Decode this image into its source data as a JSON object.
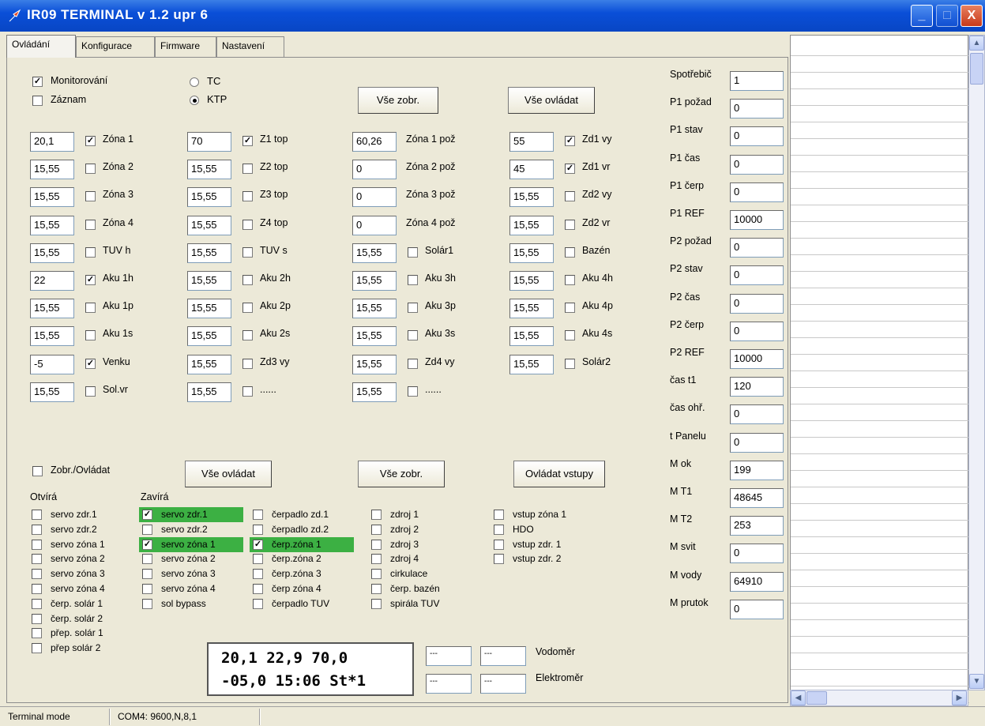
{
  "window": {
    "title": "IR09 TERMINAL v 1.2 upr 6",
    "min": "_",
    "max": "□",
    "close": "X"
  },
  "tabs": [
    "Ovládání",
    "Konfigurace",
    "Firmware",
    "Nastavení"
  ],
  "top": {
    "monitorovani": {
      "label": "Monitorování",
      "checked": true
    },
    "zaznam": {
      "label": "Záznam",
      "checked": false
    },
    "tc": {
      "label": "TC",
      "selected": false
    },
    "ktp": {
      "label": "KTP",
      "selected": true
    },
    "btn_vse_zobr": "Vše zobr.",
    "btn_vse_ovladat": "Vše ovládat"
  },
  "sensors": [
    [
      {
        "v": "20,1",
        "l": "Zóna 1",
        "c": true
      },
      {
        "v": "70",
        "l": "Z1 top",
        "c": true
      },
      {
        "v": "60,26",
        "l": "Zóna 1 pož",
        "c": null
      },
      {
        "v": "55",
        "l": "Zd1 vy",
        "c": true
      }
    ],
    [
      {
        "v": "15,55",
        "l": "Zóna 2",
        "c": false
      },
      {
        "v": "15,55",
        "l": "Z2 top",
        "c": false
      },
      {
        "v": "0",
        "l": "Zóna 2 pož",
        "c": null
      },
      {
        "v": "45",
        "l": "Zd1 vr",
        "c": true
      }
    ],
    [
      {
        "v": "15,55",
        "l": "Zóna 3",
        "c": false
      },
      {
        "v": "15,55",
        "l": "Z3 top",
        "c": false
      },
      {
        "v": "0",
        "l": "Zóna 3 pož",
        "c": null
      },
      {
        "v": "15,55",
        "l": "Zd2 vy",
        "c": false
      }
    ],
    [
      {
        "v": "15,55",
        "l": "Zóna 4",
        "c": false
      },
      {
        "v": "15,55",
        "l": "Z4 top",
        "c": false
      },
      {
        "v": "0",
        "l": "Zóna 4 pož",
        "c": null
      },
      {
        "v": "15,55",
        "l": "Zd2 vr",
        "c": false
      }
    ],
    [
      {
        "v": "15,55",
        "l": "TUV h",
        "c": false
      },
      {
        "v": "15,55",
        "l": "TUV s",
        "c": false
      },
      {
        "v": "15,55",
        "l": "Solár1",
        "c": false
      },
      {
        "v": "15,55",
        "l": "Bazén",
        "c": false
      }
    ],
    [
      {
        "v": "22",
        "l": "Aku 1h",
        "c": true
      },
      {
        "v": "15,55",
        "l": "Aku 2h",
        "c": false
      },
      {
        "v": "15,55",
        "l": "Aku 3h",
        "c": false
      },
      {
        "v": "15,55",
        "l": "Aku 4h",
        "c": false
      }
    ],
    [
      {
        "v": "15,55",
        "l": "Aku 1p",
        "c": false
      },
      {
        "v": "15,55",
        "l": "Aku 2p",
        "c": false
      },
      {
        "v": "15,55",
        "l": "Aku 3p",
        "c": false
      },
      {
        "v": "15,55",
        "l": "Aku 4p",
        "c": false
      }
    ],
    [
      {
        "v": "15,55",
        "l": "Aku 1s",
        "c": false
      },
      {
        "v": "15,55",
        "l": "Aku 2s",
        "c": false
      },
      {
        "v": "15,55",
        "l": "Aku 3s",
        "c": false
      },
      {
        "v": "15,55",
        "l": "Aku 4s",
        "c": false
      }
    ],
    [
      {
        "v": "-5",
        "l": "Venku",
        "c": true
      },
      {
        "v": "15,55",
        "l": "Zd3 vy",
        "c": false
      },
      {
        "v": "15,55",
        "l": "Zd4 vy",
        "c": false
      },
      {
        "v": "15,55",
        "l": "Solár2",
        "c": false
      }
    ],
    [
      {
        "v": "15,55",
        "l": "Sol.vr",
        "c": false
      },
      {
        "v": "15,55",
        "l": "......",
        "c": false
      },
      {
        "v": "15,55",
        "l": "......",
        "c": false
      },
      null
    ]
  ],
  "bottom": {
    "zobr_ovladat": {
      "label": "Zobr./Ovládat",
      "checked": false
    },
    "btn_vse_ovladat": "Vše ovládat",
    "btn_vse_zobr": "Vše zobr.",
    "btn_ovladat_vstupy": "Ovládat vstupy",
    "otvira_title": "Otvírá",
    "zavira_title": "Zavírá",
    "col1": [
      {
        "l": "servo zdr.1",
        "c": false
      },
      {
        "l": "servo zdr.2",
        "c": false
      },
      {
        "l": "servo zóna 1",
        "c": false
      },
      {
        "l": "servo zóna 2",
        "c": false
      },
      {
        "l": "servo zóna 3",
        "c": false
      },
      {
        "l": "servo zóna 4",
        "c": false
      },
      {
        "l": "čerp. solár 1",
        "c": false
      },
      {
        "l": "čerp. solár 2",
        "c": false
      },
      {
        "l": "přep. solár 1",
        "c": false
      },
      {
        "l": "přep solár 2",
        "c": false
      }
    ],
    "col2": [
      {
        "l": "servo zdr.1",
        "c": true,
        "hl": true
      },
      {
        "l": "servo zdr.2",
        "c": false
      },
      {
        "l": "servo zóna 1",
        "c": true,
        "hl": true
      },
      {
        "l": "servo zóna 2",
        "c": false
      },
      {
        "l": "servo zóna 3",
        "c": false
      },
      {
        "l": "servo zóna 4",
        "c": false
      },
      {
        "l": "sol bypass",
        "c": false
      }
    ],
    "col3": [
      {
        "l": "čerpadlo zd.1",
        "c": false
      },
      {
        "l": "čerpadlo zd.2",
        "c": false
      },
      {
        "l": "čerp.zóna 1",
        "c": true,
        "hl": true
      },
      {
        "l": "čerp.zóna 2",
        "c": false
      },
      {
        "l": "čerp.zóna 3",
        "c": false
      },
      {
        "l": "čerp zóna 4",
        "c": false
      },
      {
        "l": "čerpadlo TUV",
        "c": false
      }
    ],
    "col4": [
      {
        "l": "zdroj 1",
        "c": false
      },
      {
        "l": "zdroj 2",
        "c": false
      },
      {
        "l": "zdroj 3",
        "c": false
      },
      {
        "l": "zdroj 4",
        "c": false
      },
      {
        "l": "cirkulace",
        "c": false
      },
      {
        "l": "čerp. bazén",
        "c": false
      },
      {
        "l": "spirála TUV",
        "c": false
      }
    ],
    "col5": [
      {
        "l": "vstup zóna 1",
        "c": false
      },
      {
        "l": "HDO",
        "c": false
      },
      {
        "l": "vstup zdr. 1",
        "c": false
      },
      {
        "l": "vstup zdr. 2",
        "c": false
      }
    ],
    "lcd": {
      "line1": "20,1 22,9 70,0",
      "line2": "-05,0 15:06 St*1"
    },
    "vodomer": {
      "label": "Vodoměr",
      "a": "---",
      "b": "---"
    },
    "elektromer": {
      "label": "Elektroměr",
      "a": "---",
      "b": "---"
    }
  },
  "params": [
    {
      "l": "Spotřebič",
      "v": "1"
    },
    {
      "l": "P1 požad",
      "v": "0"
    },
    {
      "l": "P1 stav",
      "v": "0"
    },
    {
      "l": "P1 čas",
      "v": "0"
    },
    {
      "l": "P1 čerp",
      "v": "0"
    },
    {
      "l": "P1 REF",
      "v": "10000"
    },
    {
      "l": "P2 požad",
      "v": "0"
    },
    {
      "l": "P2 stav",
      "v": "0"
    },
    {
      "l": "P2 čas",
      "v": "0"
    },
    {
      "l": "P2 čerp",
      "v": "0"
    },
    {
      "l": "P2 REF",
      "v": "10000"
    },
    {
      "l": "čas t1",
      "v": "120"
    },
    {
      "l": "čas ohř.",
      "v": "0"
    },
    {
      "l": "t Panelu",
      "v": "0"
    },
    {
      "l": "M ok",
      "v": "199"
    },
    {
      "l": "M T1",
      "v": "48645"
    },
    {
      "l": "M T2",
      "v": "253"
    },
    {
      "l": "M svit",
      "v": "0"
    },
    {
      "l": "M vody",
      "v": "64910"
    },
    {
      "l": "M prutok",
      "v": "0"
    }
  ],
  "statusbar": {
    "mode": "Terminal mode",
    "port": "COM4: 9600,N,8,1"
  },
  "scroll": {
    "up": "▲",
    "down": "▼",
    "left": "◀",
    "right": "▶"
  }
}
